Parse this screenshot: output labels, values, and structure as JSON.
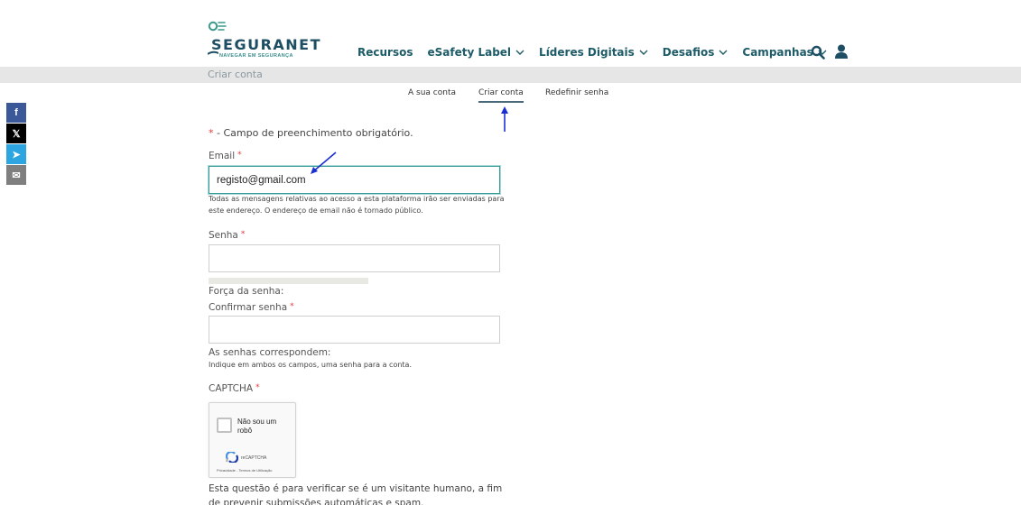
{
  "brand": {
    "name": "SEGURANET",
    "tagline": "NAVEGAR EM SEGURANÇA",
    "color": "#1d4e63",
    "accent": "#3a8c8c"
  },
  "nav": {
    "items": [
      {
        "label": "Recursos",
        "has_dropdown": false
      },
      {
        "label": "eSafety Label",
        "has_dropdown": true
      },
      {
        "label": "Líderes Digitais",
        "has_dropdown": true
      },
      {
        "label": "Desafios",
        "has_dropdown": true
      },
      {
        "label": "Campanhas",
        "has_dropdown": true
      }
    ],
    "search_icon": "search-icon",
    "user_icon": "user-icon"
  },
  "breadcrumb": {
    "title": "Criar conta"
  },
  "tabs": [
    {
      "label": "A sua conta",
      "active": false
    },
    {
      "label": "Criar conta",
      "active": true
    },
    {
      "label": "Redefinir senha",
      "active": false
    }
  ],
  "share": [
    {
      "icon": "facebook-icon",
      "glyph": "f",
      "color": "#3b5998"
    },
    {
      "icon": "x-icon",
      "glyph": "𝕏",
      "color": "#000000"
    },
    {
      "icon": "telegram-icon",
      "glyph": "➤",
      "color": "#2ca5e0"
    },
    {
      "icon": "email-icon",
      "glyph": "✉",
      "color": "#7f7f7f"
    }
  ],
  "form": {
    "required_star": "*",
    "required_note": " - Campo de preenchimento obrigatório.",
    "email": {
      "label": "Email",
      "value": "registo@gmail.com",
      "help": "Todas as mensagens relativas ao acesso a esta plataforma irão ser enviadas para este endereço. O endereço de email não é tornado público."
    },
    "password": {
      "label": "Senha",
      "value": "",
      "strength_label": "Força da senha:",
      "strength_fraction": 0
    },
    "confirm": {
      "label": "Confirmar senha",
      "value": "",
      "match_label": "As senhas correspondem:",
      "help": "Indique em ambos os campos, uma senha para a conta."
    },
    "captcha": {
      "label": "CAPTCHA",
      "checkbox_label": "Não sou um robô",
      "brand": "reCAPTCHA",
      "links": "Privacidade - Termos de Utilização",
      "description": "Esta questão é para verificar se é um visitante humano, a fim de prevenir submissões automáticas e spam."
    }
  }
}
